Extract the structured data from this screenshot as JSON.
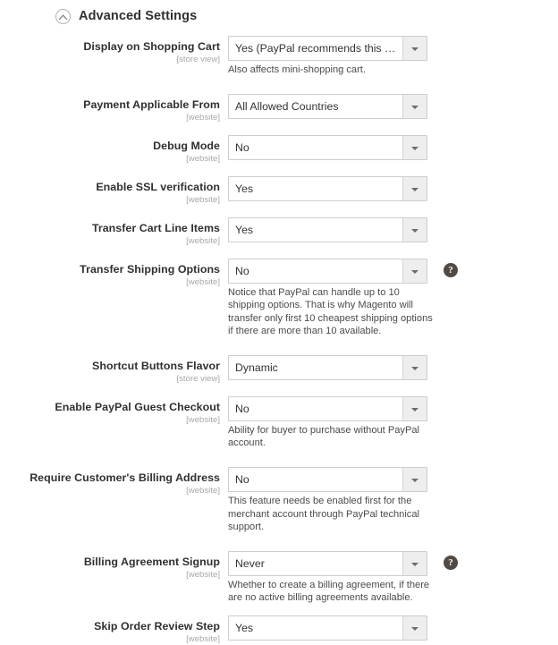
{
  "section": {
    "title": "Advanced Settings",
    "collapse_icon": "chevron-up-circle-icon",
    "expanded": true
  },
  "colors": {
    "label": "#303030",
    "scope": "#a8a8a8",
    "note": "#4b4b4b",
    "border": "#cdcdcd",
    "arrow_button": "#eeeeee",
    "help_badge": "#514943"
  },
  "fields": [
    {
      "label": "Display on Shopping Cart",
      "scope": "[store view]",
      "value": "Yes (PayPal recommends this option)",
      "note": "Also affects mini-shopping cart.",
      "help": false
    },
    {
      "label": "Payment Applicable From",
      "scope": "[website]",
      "value": "All Allowed Countries",
      "note": "",
      "help": false
    },
    {
      "label": "Debug Mode",
      "scope": "[website]",
      "value": "No",
      "note": "",
      "help": false
    },
    {
      "label": "Enable SSL verification",
      "scope": "[website]",
      "value": "Yes",
      "note": "",
      "help": false
    },
    {
      "label": "Transfer Cart Line Items",
      "scope": "[website]",
      "value": "Yes",
      "note": "",
      "help": false
    },
    {
      "label": "Transfer Shipping Options",
      "scope": "[website]",
      "value": "No",
      "note": "Notice that PayPal can handle up to 10 shipping options. That is why Magento will transfer only first 10 cheapest shipping options if there are more than 10 available.",
      "help": true,
      "help_glyph": "?"
    },
    {
      "label": "Shortcut Buttons Flavor",
      "scope": "[store view]",
      "value": "Dynamic",
      "note": "",
      "help": false
    },
    {
      "label": "Enable PayPal Guest Checkout",
      "scope": "[website]",
      "value": "No",
      "note": "Ability for buyer to purchase without PayPal account.",
      "help": false
    },
    {
      "label": "Require Customer's Billing Address",
      "scope": "[website]",
      "value": "No",
      "note": "This feature needs be enabled first for the merchant account through PayPal technical support.",
      "help": false
    },
    {
      "label": "Billing Agreement Signup",
      "scope": "[website]",
      "value": "Never",
      "note": "Whether to create a billing agreement, if there are no active billing agreements available.",
      "help": true,
      "help_glyph": "?"
    },
    {
      "label": "Skip Order Review Step",
      "scope": "[website]",
      "value": "Yes",
      "note": "",
      "help": false
    }
  ]
}
